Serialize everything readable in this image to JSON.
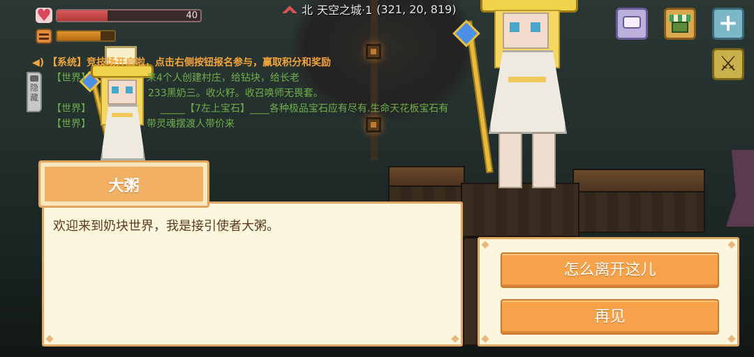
{
  "hud": {
    "health_value": "40",
    "health_fraction": 0.35,
    "hunger_fraction": 0.75,
    "location": {
      "direction": "北",
      "world": "天空之城·1",
      "coords": "(321, 20, 819)"
    },
    "icons": [
      "heart-icon",
      "hunger-icon",
      "compass-icon",
      "chat-icon",
      "shop-icon",
      "plus-icon",
      "crossed-swords-icon"
    ]
  },
  "chat": {
    "hide_label": "隐藏",
    "lines": [
      {
        "channel": "【系统】",
        "text": "竞技场开启啦，点击右侧按钮报名参与，赢取积分和奖励"
      },
      {
        "channel": "【世界】",
        "text": "来4个人创建村庄，给钻块，给长老"
      },
      {
        "channel": "",
        "text": "233黑奶三。收火籽。收召唤师无畏套。"
      },
      {
        "channel": "【世界】",
        "text": "_____【7左上宝石】____各种极品宝石应有尽有.生命天花板宝石有"
      },
      {
        "channel": "【世界】",
        "text": "带灵魂摆渡人带价来"
      }
    ]
  },
  "dialog": {
    "npc_name": "大粥",
    "message": "欢迎来到奶块世界，我是接引使者大粥。",
    "choices": [
      "怎么离开这儿",
      "再见"
    ]
  },
  "colors": {
    "system_text": "#f3a43a",
    "world_text": "#6fae4a",
    "button_orange": "#f6a24a",
    "panel_bg": "#fdf6de"
  }
}
